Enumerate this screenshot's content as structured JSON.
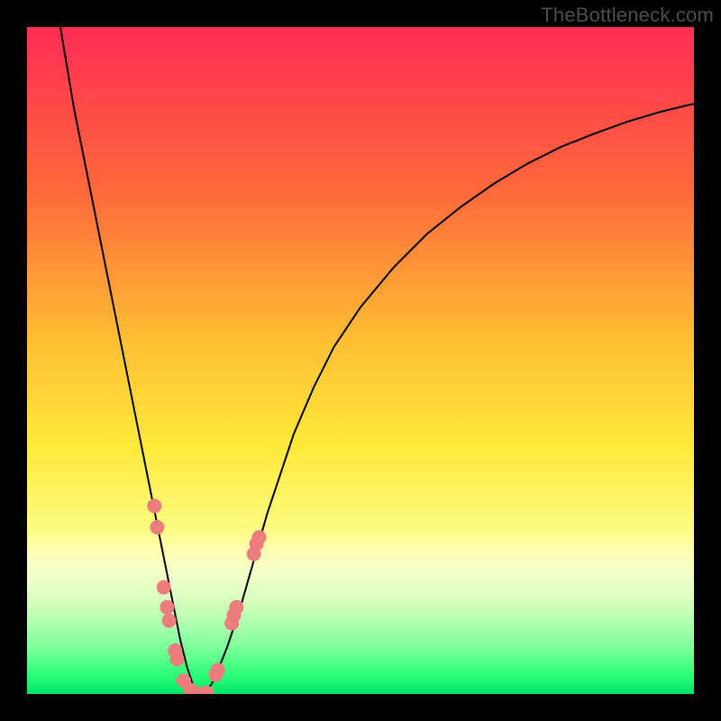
{
  "watermark": "TheBottleneck.com",
  "chart_data": {
    "type": "line",
    "title": "",
    "xlabel": "",
    "ylabel": "",
    "xlim": [
      0,
      100
    ],
    "ylim": [
      0,
      100
    ],
    "gradient_bands": [
      {
        "color": "#ff2c55",
        "stop_pct": 0
      },
      {
        "color": "#ff6a3a",
        "stop_pct": 25
      },
      {
        "color": "#ffc233",
        "stop_pct": 48
      },
      {
        "color": "#ffe93a",
        "stop_pct": 63
      },
      {
        "color": "#fffb80",
        "stop_pct": 75
      },
      {
        "color": "#fdffb8",
        "stop_pct": 79
      },
      {
        "color": "#f2ffc8",
        "stop_pct": 82
      },
      {
        "color": "#d8ffbf",
        "stop_pct": 86
      },
      {
        "color": "#a7ffab",
        "stop_pct": 90
      },
      {
        "color": "#6bff91",
        "stop_pct": 94
      },
      {
        "color": "#2eff78",
        "stop_pct": 97
      },
      {
        "color": "#00e667",
        "stop_pct": 100
      }
    ],
    "series": [
      {
        "name": "bottleneck-curve",
        "color": "#000000",
        "x": [
          5,
          6,
          7,
          8,
          9,
          10,
          11,
          12,
          13,
          14,
          15,
          16,
          17,
          18,
          19,
          20,
          21,
          22,
          23,
          24,
          25,
          26,
          27,
          28,
          30,
          32,
          34,
          36,
          38,
          40,
          43,
          46,
          50,
          55,
          60,
          65,
          70,
          75,
          80,
          85,
          90,
          95,
          100
        ],
        "y": [
          100,
          94,
          88,
          83,
          78,
          73,
          68,
          63,
          58,
          53,
          48,
          43,
          38,
          33,
          28,
          23,
          18,
          13,
          8,
          4,
          1,
          0,
          0.5,
          2,
          7,
          13,
          20,
          27,
          33,
          39,
          46,
          52,
          58,
          64,
          69,
          73,
          76.5,
          79.5,
          82,
          84,
          85.8,
          87.3,
          88.5
        ]
      }
    ],
    "highlight_points": {
      "name": "bottleneck-markers",
      "color": "#ed7d7d",
      "points": [
        {
          "x": 19.1,
          "y": 28.2
        },
        {
          "x": 19.5,
          "y": 25.0
        },
        {
          "x": 20.5,
          "y": 16.0
        },
        {
          "x": 21.0,
          "y": 13.0
        },
        {
          "x": 21.3,
          "y": 11.0
        },
        {
          "x": 22.2,
          "y": 6.5
        },
        {
          "x": 22.5,
          "y": 5.2
        },
        {
          "x": 23.5,
          "y": 2.0
        },
        {
          "x": 24.5,
          "y": 0.6
        },
        {
          "x": 25.5,
          "y": 0.0
        },
        {
          "x": 26.9,
          "y": 0.2
        },
        {
          "x": 28.3,
          "y": 2.9
        },
        {
          "x": 28.6,
          "y": 3.6
        },
        {
          "x": 30.7,
          "y": 10.6
        },
        {
          "x": 31.0,
          "y": 11.8
        },
        {
          "x": 31.4,
          "y": 13.0
        },
        {
          "x": 34.0,
          "y": 21.0
        },
        {
          "x": 34.4,
          "y": 22.5
        },
        {
          "x": 34.8,
          "y": 23.5
        }
      ]
    }
  }
}
